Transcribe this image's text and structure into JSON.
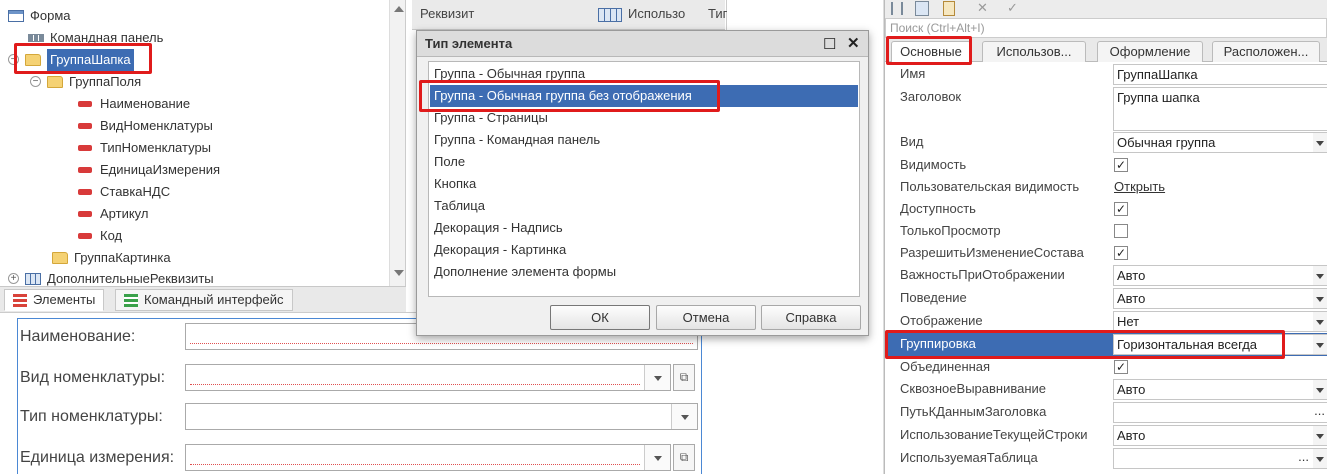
{
  "tree": {
    "items": [
      {
        "label": "Форма",
        "icon": "form-icon"
      },
      {
        "label": "Командная панель",
        "icon": "command-panel-icon"
      },
      {
        "label": "ГруппаШапка",
        "icon": "folder-icon"
      },
      {
        "label": "ГруппаПоля",
        "icon": "folder-icon"
      },
      {
        "label": "Наименование",
        "icon": "field-icon"
      },
      {
        "label": "ВидНоменклатуры",
        "icon": "field-icon"
      },
      {
        "label": "ТипНоменклатуры",
        "icon": "field-icon"
      },
      {
        "label": "ЕдиницаИзмерения",
        "icon": "field-icon"
      },
      {
        "label": "СтавкаНДС",
        "icon": "field-icon"
      },
      {
        "label": "Артикул",
        "icon": "field-icon"
      },
      {
        "label": "Код",
        "icon": "field-icon"
      },
      {
        "label": "ГруппаКартинка",
        "icon": "folder-icon"
      },
      {
        "label": "ДополнительныеРеквизиты",
        "icon": "table-icon"
      }
    ],
    "expand": "+",
    "collapse": "−"
  },
  "bottom_tabs": [
    "Элементы",
    "Командный интерфейс"
  ],
  "preview": {
    "fields": [
      {
        "label": "Наименование:"
      },
      {
        "label": "Вид номенклатуры:"
      },
      {
        "label": "Тип номенклатуры:"
      },
      {
        "label": "Единица измерения:"
      }
    ],
    "open_glyph": "⧉"
  },
  "attributes": {
    "columns": [
      "Реквизит",
      "Использо",
      "Тип"
    ]
  },
  "dialog": {
    "title": "Тип элемента",
    "items": [
      "Группа - Обычная группа",
      "Группа - Обычная группа без отображения",
      "Группа - Страницы",
      "Группа - Командная панель",
      "Поле",
      "Кнопка",
      "Таблица",
      "Декорация - Надпись",
      "Декорация - Картинка",
      "Дополнение элемента формы"
    ],
    "selected_index": 1,
    "buttons": {
      "ok": "ОК",
      "cancel": "Отмена",
      "help": "Справка"
    },
    "maximize_glyph": "☐",
    "close_glyph": "✕"
  },
  "properties": {
    "search_placeholder": "Поиск (Ctrl+Alt+I)",
    "tabs": [
      "Основные",
      "Использов...",
      "Оформление",
      "Расположен..."
    ],
    "rows": [
      {
        "name": "Имя",
        "type": "text",
        "value": "ГруппаШапка"
      },
      {
        "name": "Заголовок",
        "type": "textarea",
        "value": "Группа шапка"
      },
      {
        "name": "Вид",
        "type": "select",
        "value": "Обычная группа"
      },
      {
        "name": "Видимость",
        "type": "check",
        "checked": true
      },
      {
        "name": "Пользовательская видимость",
        "type": "link",
        "value": "Открыть"
      },
      {
        "name": "Доступность",
        "type": "check",
        "checked": true
      },
      {
        "name": "ТолькоПросмотр",
        "type": "check",
        "checked": false
      },
      {
        "name": "РазрешитьИзменениеСостава",
        "type": "check",
        "checked": true
      },
      {
        "name": "ВажностьПриОтображении",
        "type": "select",
        "value": "Авто"
      },
      {
        "name": "Поведение",
        "type": "select",
        "value": "Авто"
      },
      {
        "name": "Отображение",
        "type": "select",
        "value": "Нет"
      },
      {
        "name": "Группировка",
        "type": "select",
        "value": "Горизонтальная всегда"
      },
      {
        "name": "Объединенная",
        "type": "check",
        "checked": true
      },
      {
        "name": "СквозноеВыравнивание",
        "type": "select",
        "value": "Авто"
      },
      {
        "name": "ПутьКДаннымЗаголовка",
        "type": "ellipsis",
        "value": ""
      },
      {
        "name": "ИспользованиеТекущейСтроки",
        "type": "select",
        "value": "Авто"
      },
      {
        "name": "ИспользуемаяТаблица",
        "type": "ellipsis-select",
        "value": ""
      }
    ],
    "check_glyph": "✓",
    "ellipsis_glyph": "..."
  },
  "colors": {
    "selection": "#3d6cb3",
    "highlight_box": "#e01b1b"
  }
}
